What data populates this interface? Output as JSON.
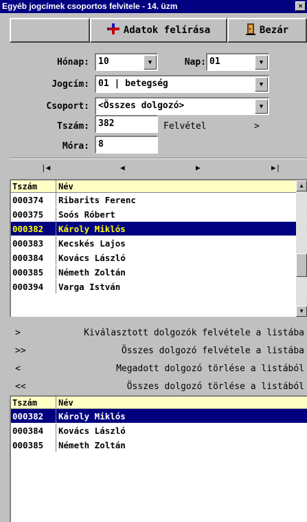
{
  "window": {
    "title": "Egyéb jogcímek csoportos felvitele - 14. üzm",
    "close": "×"
  },
  "toolbar": {
    "save_label": "Adatok felírása",
    "close_label": "Bezár"
  },
  "form": {
    "honap_label": "Hónap:",
    "honap_value": "10",
    "nap_label": "Nap:",
    "nap_value": "01",
    "jogcim_label": "Jogcím:",
    "jogcim_value": "01 | betegség",
    "csoport_label": "Csoport:",
    "csoport_value": "<Összes dolgozó>",
    "tszam_label": "Tszám:",
    "tszam_value": "382",
    "felvetel_text": "Felvétel",
    "felvetel_arrow": ">",
    "mora_label": "Móra:",
    "mora_value": "8"
  },
  "navigator": {
    "first": "|◀",
    "prev": "◀",
    "next": "▶",
    "last": "▶|"
  },
  "source_grid": {
    "headers": [
      "Tszám",
      "Név"
    ],
    "rows": [
      [
        "000374",
        "Ribarits Ferenc"
      ],
      [
        "000375",
        "Soós Róbert"
      ],
      [
        "000382",
        "Károly Miklós"
      ],
      [
        "000383",
        "Kecskés Lajos"
      ],
      [
        "000384",
        "Kovács László"
      ],
      [
        "000385",
        "Németh Zoltán"
      ],
      [
        "000394",
        "Varga István"
      ]
    ],
    "selected_index": 2
  },
  "actions": [
    {
      "symbol": ">",
      "label": "Kiválasztott dolgozók felvétele a listába"
    },
    {
      "symbol": ">>",
      "label": "Összes dolgozó felvétele a listába"
    },
    {
      "symbol": "<",
      "label": "Megadott dolgozó törlése a listából"
    },
    {
      "symbol": "<<",
      "label": "Összes dolgozó törlése a listából"
    }
  ],
  "target_grid": {
    "headers": [
      "Tszám",
      "Név"
    ],
    "rows": [
      [
        "000382",
        "Károly Miklós"
      ],
      [
        "000384",
        "Kovács László"
      ],
      [
        "000385",
        "Németh Zoltán"
      ]
    ],
    "selected_index": 0
  },
  "colors": {
    "title_bg": "#000080",
    "grid_header_bg": "#ffffc4",
    "selection_bg": "#000080",
    "selection_fg": "#ffff00"
  }
}
